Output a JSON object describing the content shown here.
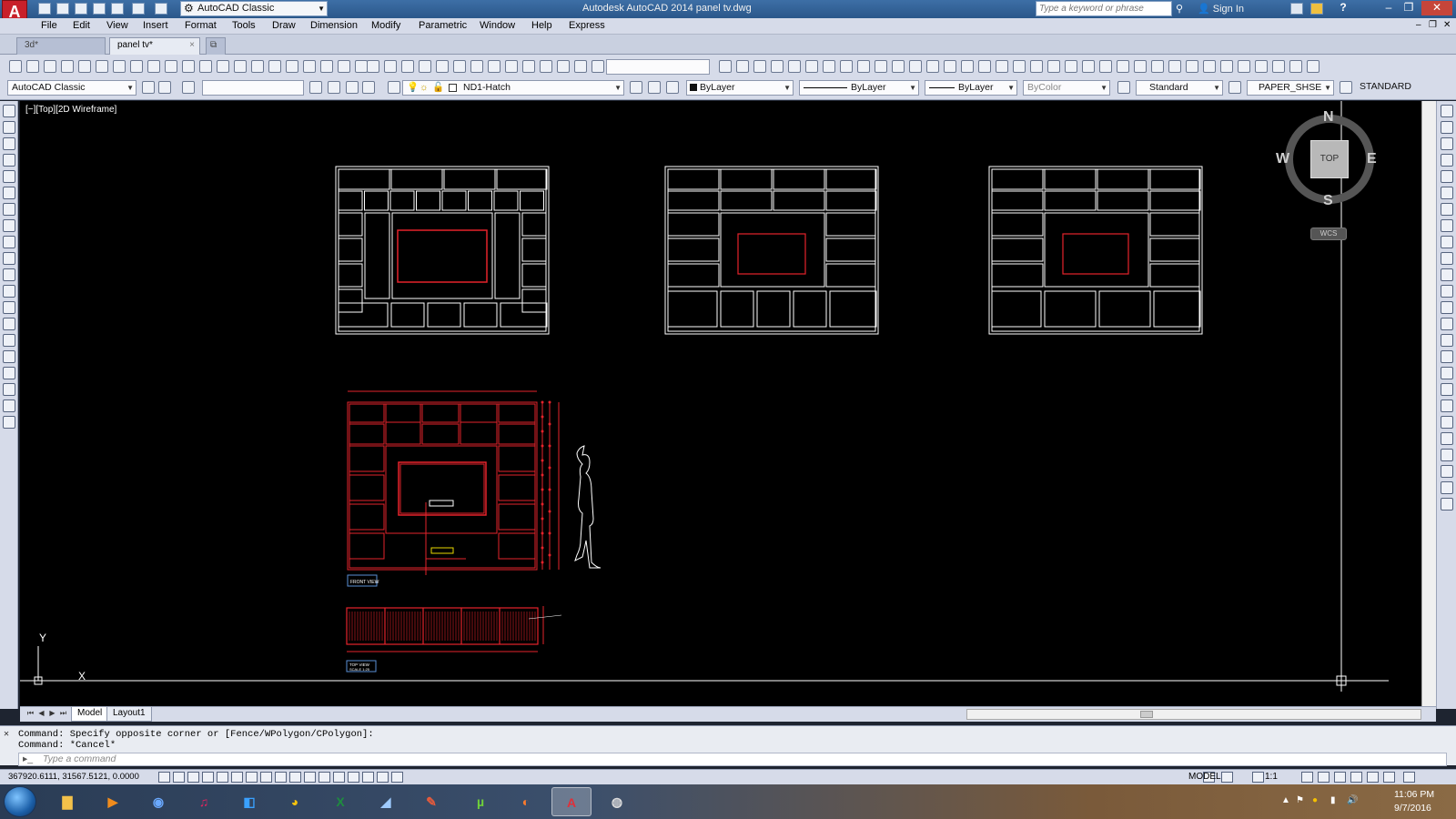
{
  "titlebar": {
    "workspace": "AutoCAD Classic",
    "window_title": "Autodesk AutoCAD 2014    panel tv.dwg",
    "search_placeholder": "Type a keyword or phrase",
    "sign_in": "Sign In",
    "help": "?"
  },
  "menu": [
    "File",
    "Edit",
    "View",
    "Insert",
    "Format",
    "Tools",
    "Draw",
    "Dimension",
    "Modify",
    "Parametric",
    "Window",
    "Help",
    "Express"
  ],
  "file_tabs": [
    {
      "label": "3d*"
    },
    {
      "label": "panel tv*",
      "close": "×"
    }
  ],
  "toolbar": {
    "workspace_combo": "AutoCAD Classic",
    "layer_combo": "ND1-Hatch",
    "color_combo": "ByLayer",
    "linetype_combo": "ByLayer",
    "lineweight_combo": "ByLayer",
    "plotstyle_combo": "ByColor",
    "textstyle_combo": "Standard",
    "dimstyle_combo": "PAPER_SHSE",
    "tablestyle_combo": "STANDARD"
  },
  "viewport": {
    "label": "[−][Top][2D Wireframe]"
  },
  "viewcube": {
    "north": "N",
    "south": "S",
    "east": "E",
    "west": "W",
    "face": "TOP",
    "wcs": "WCS"
  },
  "ucs": {
    "x": "X",
    "y": "Y"
  },
  "drawing_labels": {
    "front_view": "FRONT VIEW",
    "top_view": "TOP VIEW",
    "top_scale": "SCALE 1:25"
  },
  "layout_tabs": [
    "Model",
    "Layout1"
  ],
  "command": {
    "history": [
      "Command: Specify opposite corner or [Fence/WPolygon/CPolygon]:",
      "Command: *Cancel*"
    ],
    "placeholder": "Type a command"
  },
  "status": {
    "coords": "367920.6111, 31567.5121, 0.0000",
    "model": "MODEL",
    "scale": "1:1"
  },
  "taskbar": {
    "time": "11:06 PM",
    "date": "9/7/2016"
  },
  "colors": {
    "canvas": "#000000",
    "drawing_lines": "#ffffff",
    "dimension_red": "#e5232b",
    "accent_yellow": "#e8d800"
  }
}
